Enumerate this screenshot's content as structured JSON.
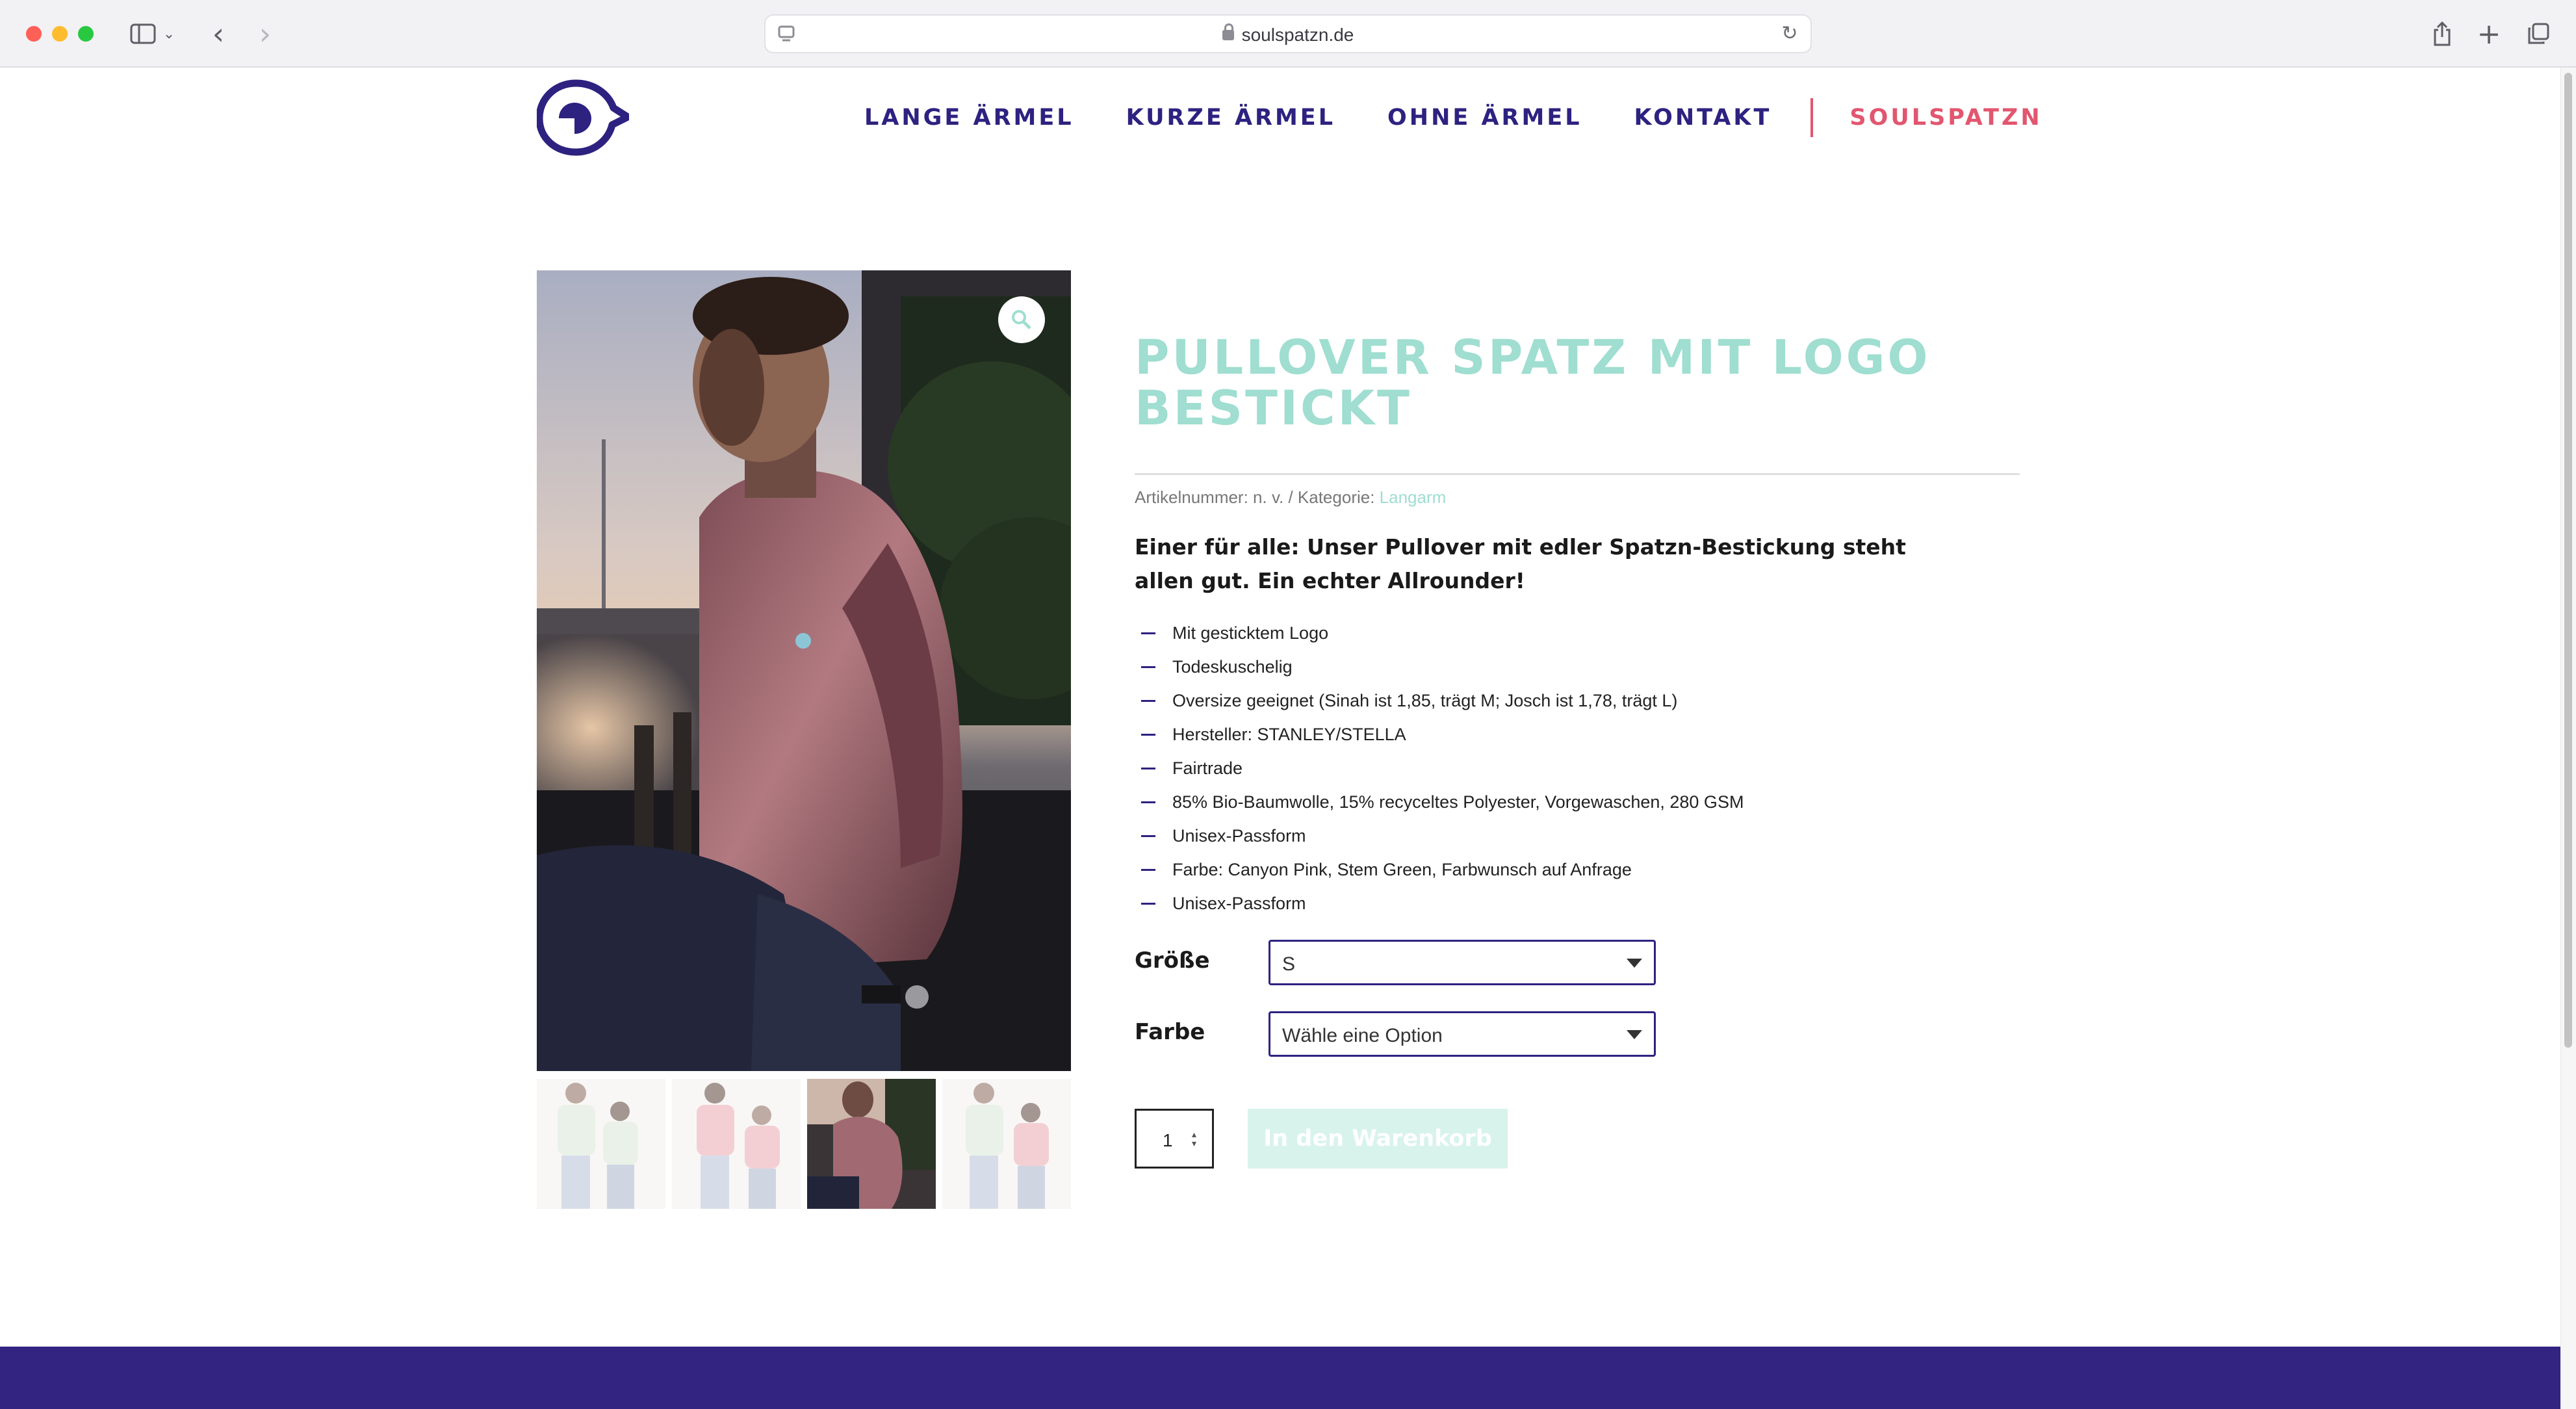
{
  "browser": {
    "url": "soulspatzn.de"
  },
  "nav": {
    "items": [
      "LANGE ÄRMEL",
      "KURZE ÄRMEL",
      "OHNE ÄRMEL",
      "KONTAKT"
    ],
    "brand": "SOULSPATZN"
  },
  "product": {
    "title": "PULLOVER SPATZ MIT LOGO BESTICKT",
    "meta_prefix": "Artikelnummer: n. v. / Kategorie: ",
    "category": "Langarm",
    "intro": "Einer für alle: Unser Pullover mit edler Spatzn-Bestickung steht allen gut. Ein echter Allrounder!",
    "features": [
      "Mit gesticktem Logo",
      "Todeskuschelig",
      "Oversize geeignet (Sinah ist 1,85, trägt M; Josch ist 1,78, trägt L)",
      "Hersteller: STANLEY/STELLA",
      "Fairtrade",
      "85% Bio-Baumwolle, 15% recyceltes Polyester, Vorgewaschen, 280 GSM",
      "Unisex-Passform",
      "Farbe: Canyon Pink, Stem Green, Farbwunsch auf Anfrage",
      "Unisex-Passform"
    ]
  },
  "variations": {
    "size_label": "Größe",
    "size_value": "S",
    "color_label": "Farbe",
    "color_value": "Wähle eine Option"
  },
  "cart": {
    "quantity": "1",
    "add_label": "In den Warenkorb"
  },
  "colors": {
    "brand_purple": "#2d2280",
    "brand_pink": "#e2566f",
    "mint": "#9fded0",
    "footer": "#322480"
  },
  "icons": {
    "zoom": "magnifier-icon",
    "logo": "sparrow-eye-logo"
  }
}
